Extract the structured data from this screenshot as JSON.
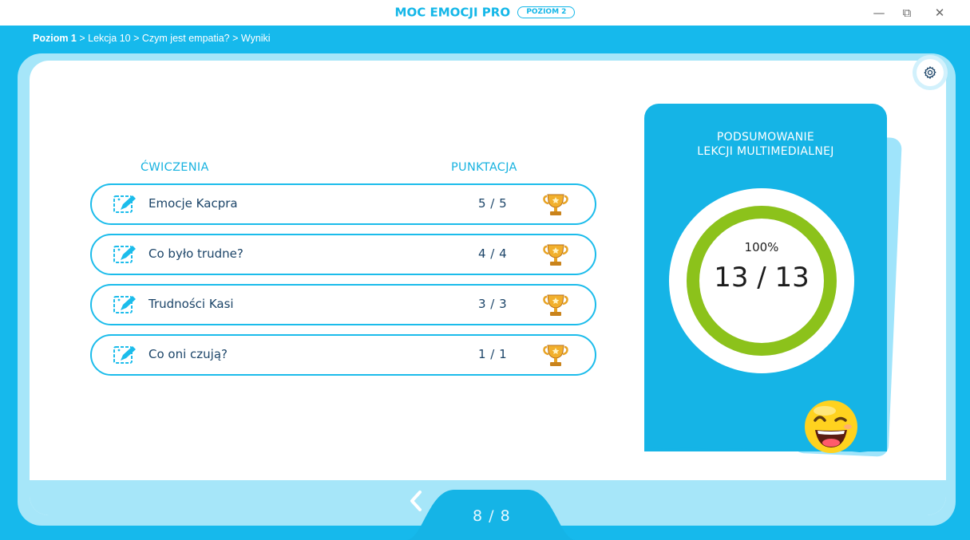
{
  "window": {
    "title": "MOC EMOCJI PRO",
    "level_badge": "POZIOM 2",
    "controls": {
      "minimize": "—",
      "restore": "⧉",
      "close": "✕"
    }
  },
  "breadcrumb": {
    "first": "Poziom 1",
    "rest": " > Lekcja 10 > Czym jest empatia? > Wyniki"
  },
  "table": {
    "headers": {
      "exercises": "ĆWICZENIA",
      "score": "PUNKTACJA"
    },
    "rows": [
      {
        "name": "Emocje Kacpra",
        "score": "5 / 5"
      },
      {
        "name": "Co było trudne?",
        "score": "4 / 4"
      },
      {
        "name": "Trudności Kasi",
        "score": "3 / 3"
      },
      {
        "name": "Co oni czują?",
        "score": "1 / 1"
      }
    ]
  },
  "summary": {
    "title_line1": "PODSUMOWANIE",
    "title_line2": "LEKCJI MULTIMEDIALNEJ",
    "percent": "100%",
    "ratio": "13 / 13",
    "progress_fraction": 1.0
  },
  "pager": {
    "text": "8 / 8"
  },
  "colors": {
    "accent": "#16b9ec",
    "light_accent": "#a6e6f9",
    "progress": "#8cc21b",
    "text_dark": "#1b4468",
    "trophy": "#e8a323"
  },
  "icons": [
    "settings-gear-icon",
    "edit-task-icon",
    "trophy-icon",
    "chevron-left-icon",
    "winking-emoji-icon"
  ]
}
